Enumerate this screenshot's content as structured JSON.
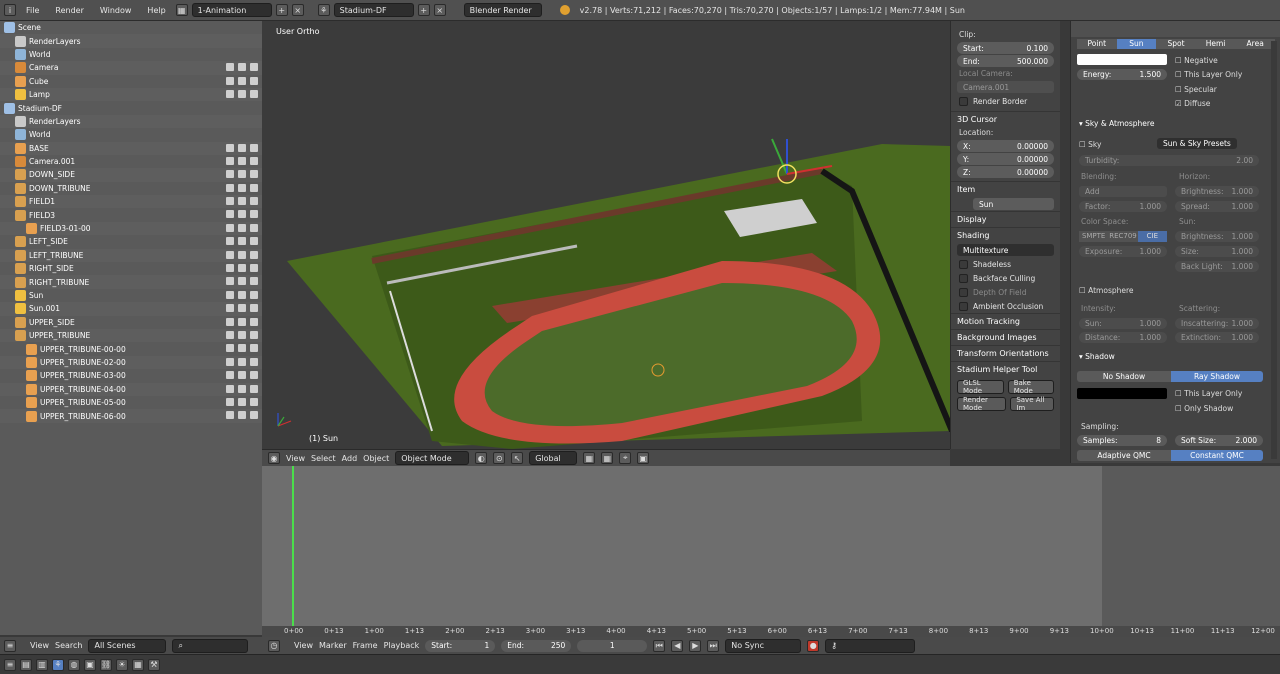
{
  "topbar": {
    "menus": [
      "File",
      "Render",
      "Window",
      "Help"
    ],
    "layout": "1-Animation",
    "scene": "Stadium-DF",
    "engine": "Blender Render",
    "stats": "v2.78 | Verts:71,212 | Faces:70,270 | Tris:70,270 | Objects:1/57 | Lamps:1/2 | Mem:77.94M | Sun"
  },
  "outliner": {
    "rows": [
      {
        "label": "Scene",
        "indent": 0,
        "type": "scene"
      },
      {
        "label": "RenderLayers",
        "indent": 1,
        "type": "layers"
      },
      {
        "label": "World",
        "indent": 1,
        "type": "world"
      },
      {
        "label": "Camera",
        "indent": 1,
        "type": "camera"
      },
      {
        "label": "Cube",
        "indent": 1,
        "type": "mesh"
      },
      {
        "label": "Lamp",
        "indent": 1,
        "type": "lamp"
      },
      {
        "label": "Stadium-DF",
        "indent": 0,
        "type": "scene"
      },
      {
        "label": "RenderLayers",
        "indent": 1,
        "type": "layers"
      },
      {
        "label": "World",
        "indent": 1,
        "type": "world"
      },
      {
        "label": "BASE",
        "indent": 1,
        "type": "mesh"
      },
      {
        "label": "Camera.001",
        "indent": 1,
        "type": "camera"
      },
      {
        "label": "DOWN_SIDE",
        "indent": 1,
        "type": "empty"
      },
      {
        "label": "DOWN_TRIBUNE",
        "indent": 1,
        "type": "empty"
      },
      {
        "label": "FIELD1",
        "indent": 1,
        "type": "empty"
      },
      {
        "label": "FIELD3",
        "indent": 1,
        "type": "empty"
      },
      {
        "label": "FIELD3-01-00",
        "indent": 2,
        "type": "mesh"
      },
      {
        "label": "LEFT_SIDE",
        "indent": 1,
        "type": "empty"
      },
      {
        "label": "LEFT_TRIBUNE",
        "indent": 1,
        "type": "empty"
      },
      {
        "label": "RIGHT_SIDE",
        "indent": 1,
        "type": "empty"
      },
      {
        "label": "RIGHT_TRIBUNE",
        "indent": 1,
        "type": "empty"
      },
      {
        "label": "Sun",
        "indent": 1,
        "type": "lamp"
      },
      {
        "label": "Sun.001",
        "indent": 1,
        "type": "lamp"
      },
      {
        "label": "UPPER_SIDE",
        "indent": 1,
        "type": "empty"
      },
      {
        "label": "UPPER_TRIBUNE",
        "indent": 1,
        "type": "empty"
      },
      {
        "label": "UPPER_TRIBUNE-00-00",
        "indent": 2,
        "type": "mesh"
      },
      {
        "label": "UPPER_TRIBUNE-02-00",
        "indent": 2,
        "type": "mesh"
      },
      {
        "label": "UPPER_TRIBUNE-03-00",
        "indent": 2,
        "type": "mesh"
      },
      {
        "label": "UPPER_TRIBUNE-04-00",
        "indent": 2,
        "type": "mesh"
      },
      {
        "label": "UPPER_TRIBUNE-05-00",
        "indent": 2,
        "type": "mesh"
      },
      {
        "label": "UPPER_TRIBUNE-06-00",
        "indent": 2,
        "type": "mesh"
      }
    ],
    "footer": {
      "view": "View",
      "search": "Search",
      "filter": "All Scenes"
    }
  },
  "viewport": {
    "label": "User Ortho",
    "selected": "(1) Sun"
  },
  "vp_header": {
    "view": "View",
    "select": "Select",
    "add": "Add",
    "object": "Object",
    "mode": "Object Mode",
    "orientation": "Global"
  },
  "npanel": {
    "clip_label": "Clip:",
    "start_label": "Start:",
    "start_value": "0.100",
    "end_label": "End:",
    "end_value": "500.000",
    "local_camera_label": "Local Camera:",
    "local_camera_value": "Camera.001",
    "render_border": "Render Border",
    "cursor_header": "3D Cursor",
    "location_label": "Location:",
    "x_label": "X:",
    "x_value": "0.00000",
    "y_label": "Y:",
    "y_value": "0.00000",
    "z_label": "Z:",
    "z_value": "0.00000",
    "item_header": "Item",
    "item_value": "Sun",
    "display_header": "Display",
    "shading_header": "Shading",
    "shading_mode": "Multitexture",
    "shadeless": "Shadeless",
    "backface": "Backface Culling",
    "dof": "Depth Of Field",
    "ao": "Ambient Occlusion",
    "motion": "Motion Tracking",
    "bgimages": "Background Images",
    "transform": "Transform Orientations",
    "helper": "Stadium Helper Tool",
    "glsl": "GLSL Mode",
    "bake": "Bake Mode",
    "render_mode": "Render Mode",
    "save_all": "Save All Im"
  },
  "props": {
    "lamp_tabs": [
      "Point",
      "Sun",
      "Spot",
      "Hemi",
      "Area"
    ],
    "negative": "Negative",
    "energy_label": "Energy:",
    "energy_value": "1.500",
    "this_layer": "This Layer Only",
    "specular": "Specular",
    "diffuse": "Diffuse",
    "sky_header": "Sky & Atmosphere",
    "sky": "Sky",
    "sky_presets": "Sun & Sky Presets",
    "turbidity_label": "Turbidity:",
    "turbidity_value": "2.00",
    "blending_label": "Blending:",
    "horizon_label": "Horizon:",
    "add_label": "Add",
    "h_brightness_label": "Brightness:",
    "h_brightness_value": "1.000",
    "factor_label": "Factor:",
    "factor_value": "1.000",
    "spread_label": "Spread:",
    "spread_value": "1.000",
    "color_space_label": "Color Space:",
    "sun_label": "Sun:",
    "cs_options": [
      "SMPTE",
      "REC709",
      "CIE"
    ],
    "s_brightness_label": "Brightness:",
    "s_brightness_value": "1.000",
    "exposure_label": "Exposure:",
    "exposure_value": "1.000",
    "size_label": "Size:",
    "size_value": "1.000",
    "backlight_label": "Back Light:",
    "backlight_value": "1.000",
    "atmosphere": "Atmosphere",
    "intensity_label": "Intensity:",
    "scattering_label": "Scattering:",
    "i_sun_label": "Sun:",
    "i_sun_value": "1.000",
    "inscattering_label": "Inscattering:",
    "inscattering_value": "1.000",
    "distance_label": "Distance:",
    "distance_value": "1.000",
    "extinction_label": "Extinction:",
    "extinction_value": "1.000",
    "shadow_header": "Shadow",
    "no_shadow": "No Shadow",
    "ray_shadow": "Ray Shadow",
    "sh_this_layer": "This Layer Only",
    "only_shadow": "Only Shadow",
    "sampling_label": "Sampling:",
    "samples_label": "Samples:",
    "samples_value": "8",
    "soft_label": "Soft Size:",
    "soft_value": "2.000",
    "adaptive": "Adaptive QMC",
    "constant": "Constant QMC"
  },
  "timeline": {
    "ticks": [
      "0+00",
      "0+13",
      "1+00",
      "1+13",
      "2+00",
      "2+13",
      "3+00",
      "3+13",
      "4+00",
      "4+13",
      "5+00",
      "5+13",
      "6+00",
      "6+13",
      "7+00",
      "7+13",
      "8+00",
      "8+13",
      "9+00",
      "9+13",
      "10+00",
      "10+13",
      "11+00",
      "11+13",
      "12+00"
    ],
    "view": "View",
    "marker": "Marker",
    "frame": "Frame",
    "playback": "Playback",
    "start_label": "Start:",
    "start_value": "1",
    "end_label": "End:",
    "end_value": "250",
    "current": "1",
    "sync": "No Sync"
  },
  "colors": {
    "accent": "#5680c2",
    "track": "#c94c3f",
    "grass": "#4a6a1f"
  }
}
